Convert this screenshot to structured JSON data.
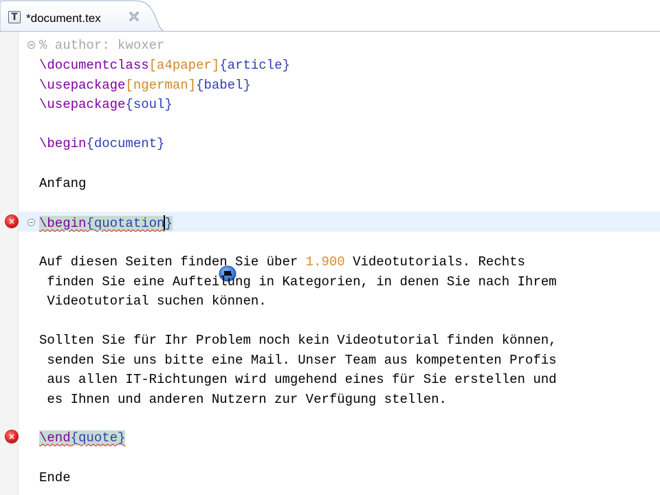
{
  "tab": {
    "icon_letter": "T",
    "title": "*document.tex",
    "close_icon": "close-icon"
  },
  "editor": {
    "lines": {
      "l1": {
        "comment": "% author: kwoxer"
      },
      "l2": {
        "cmd": "\\documentclass",
        "opt": "[a4paper]",
        "arg": "{article}"
      },
      "l3": {
        "cmd": "\\usepackage",
        "opt": "[ngerman]",
        "arg": "{babel}"
      },
      "l4": {
        "cmd": "\\usepackage",
        "arg": "{soul}"
      },
      "l5": {
        "cmd": "\\begin",
        "arg": "{document}"
      },
      "l6": {
        "text": "Anfang"
      },
      "l7": {
        "cmd": "\\begin",
        "arg_a": "{quotation",
        "arg_b": "}"
      },
      "p1": {
        "a": "Auf diesen Seiten finden Sie über ",
        "num": "1.900",
        "b": " Videotutorials. Rechts",
        "c": " finden Sie eine Aufteilung in Kategorien, in denen Sie nach Ihrem",
        "d": " Videotutorial suchen können."
      },
      "p2": {
        "a": "Sollten Sie für Ihr Problem noch kein Videotutorial finden können,",
        "b": " senden Sie uns bitte eine Mail. Unser Team aus kompetenten Profis",
        "c": " aus allen IT-Richtungen wird umgehend eines für Sie erstellen und",
        "d": " es Ihnen und anderen Nutzern zur Verfügung stellen."
      },
      "l8": {
        "cmd": "\\end",
        "arg": "{quote}"
      },
      "l9": {
        "text": "Ende"
      }
    },
    "error_glyph": "×",
    "icons": {
      "error": "error-icon",
      "fold": "fold-collapse-icon",
      "quickfix": "quick-fix-icon"
    }
  }
}
